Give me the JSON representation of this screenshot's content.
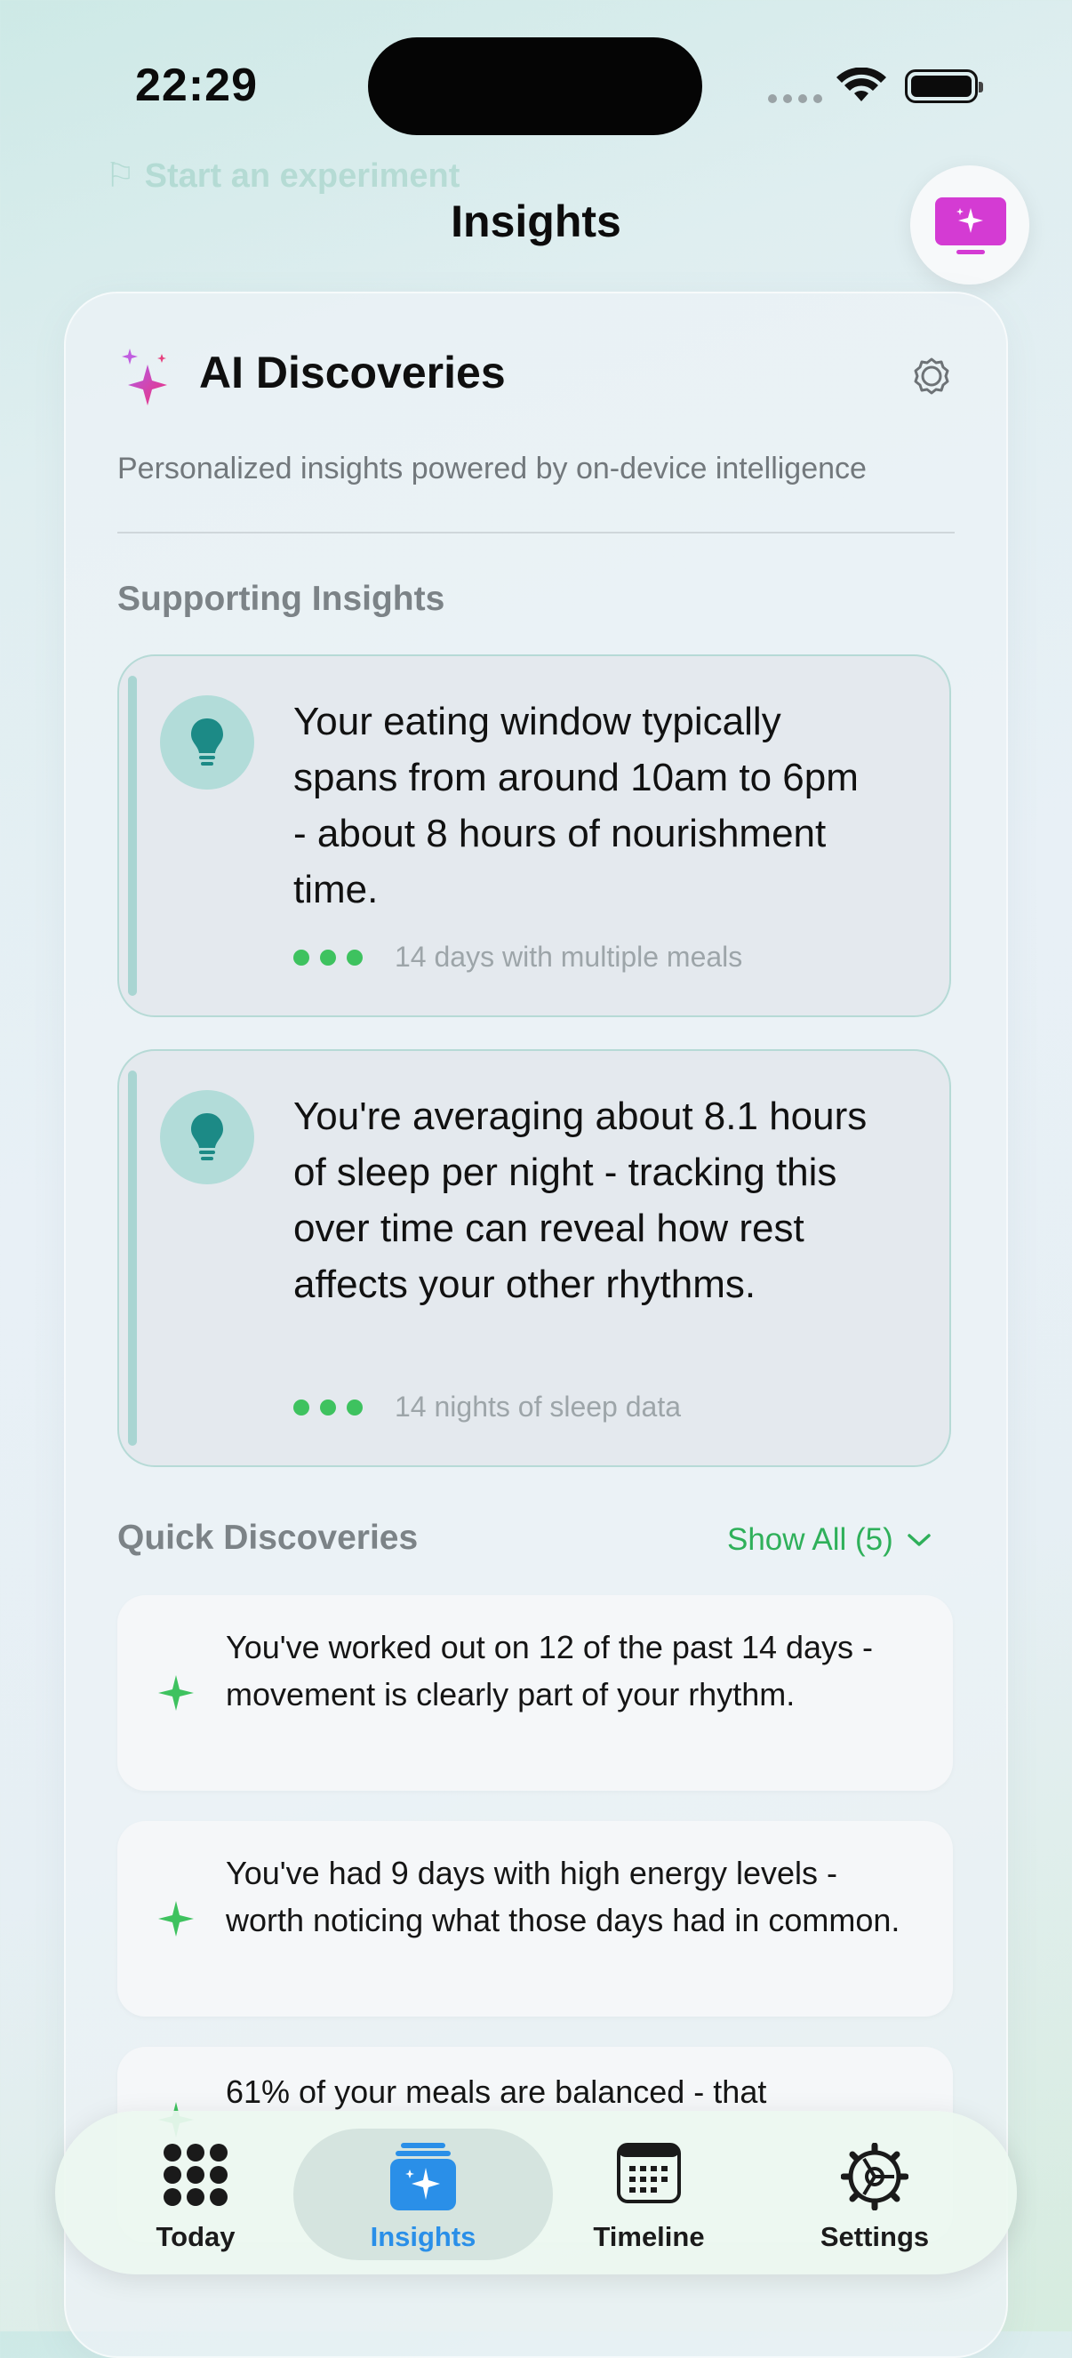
{
  "status_bar": {
    "time": "22:29"
  },
  "header": {
    "title": "Insights",
    "ai_button_icon": "ai-screen-sparkle-icon"
  },
  "ai_card": {
    "title": "AI Discoveries",
    "subtitle": "Personalized insights powered by on-device intelligence",
    "icon": "sparkles-icon",
    "settings_icon": "gear-icon"
  },
  "supporting": {
    "label": "Supporting Insights",
    "items": [
      {
        "text": "Your eating window typically spans from around 10am to 6pm - about 8 hours of nourishment time.",
        "meta": "14 days with multiple meals",
        "confidence_dots": 3
      },
      {
        "text": "You're averaging about 8.1 hours of sleep per night - tracking this over time can reveal how rest affects your other rhythms.",
        "meta": "14 nights of sleep data",
        "confidence_dots": 3
      }
    ]
  },
  "quick": {
    "label": "Quick Discoveries",
    "show_all": "Show All (5)",
    "items": [
      {
        "text": "You've worked out on 12 of the past 14 days - movement is clearly part of your rhythm."
      },
      {
        "text": "You've had 9 days with high energy levels - worth noticing what those days had in common."
      },
      {
        "text": "61% of your meals are balanced - that"
      }
    ]
  },
  "tabbar": {
    "tabs": [
      {
        "label": "Today",
        "icon": "grid-dots-icon"
      },
      {
        "label": "Insights",
        "icon": "sparkle-stack-icon",
        "active": true
      },
      {
        "label": "Timeline",
        "icon": "calendar-icon"
      },
      {
        "label": "Settings",
        "icon": "gear-icon"
      }
    ]
  },
  "colors": {
    "accent_green": "#3ec25f",
    "accent_blue": "#2a8fe8",
    "ai_magenta": "#d43bd3",
    "teal": "#a9d5d2"
  }
}
